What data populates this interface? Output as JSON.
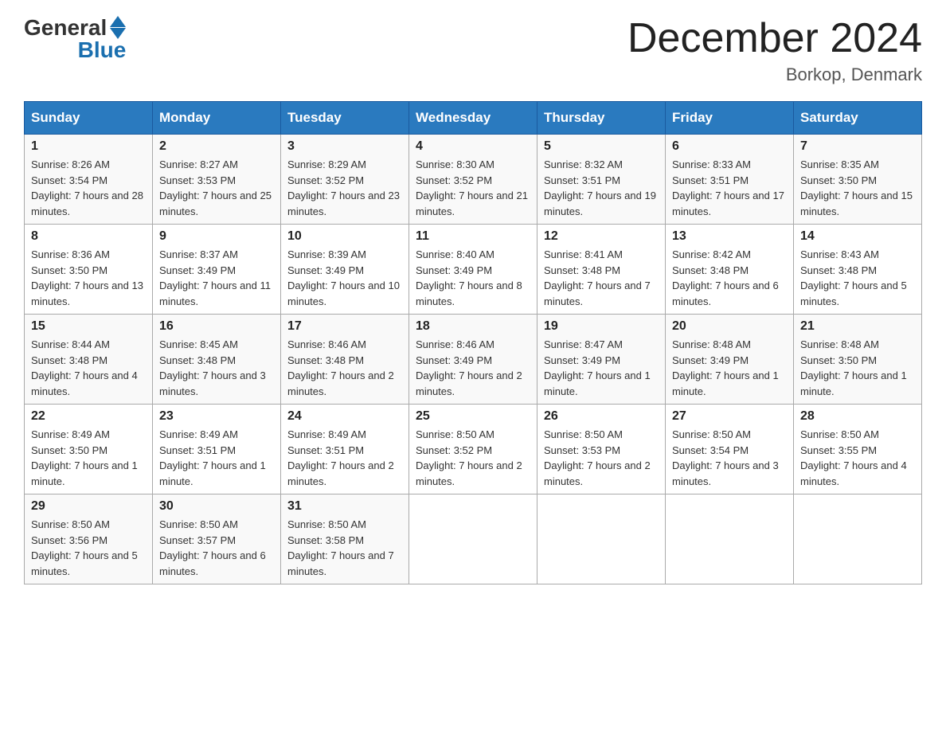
{
  "header": {
    "logo_general": "General",
    "logo_blue": "Blue",
    "title": "December 2024",
    "subtitle": "Borkop, Denmark"
  },
  "weekdays": [
    "Sunday",
    "Monday",
    "Tuesday",
    "Wednesday",
    "Thursday",
    "Friday",
    "Saturday"
  ],
  "weeks": [
    [
      {
        "day": "1",
        "sunrise": "8:26 AM",
        "sunset": "3:54 PM",
        "daylight": "7 hours and 28 minutes."
      },
      {
        "day": "2",
        "sunrise": "8:27 AM",
        "sunset": "3:53 PM",
        "daylight": "7 hours and 25 minutes."
      },
      {
        "day": "3",
        "sunrise": "8:29 AM",
        "sunset": "3:52 PM",
        "daylight": "7 hours and 23 minutes."
      },
      {
        "day": "4",
        "sunrise": "8:30 AM",
        "sunset": "3:52 PM",
        "daylight": "7 hours and 21 minutes."
      },
      {
        "day": "5",
        "sunrise": "8:32 AM",
        "sunset": "3:51 PM",
        "daylight": "7 hours and 19 minutes."
      },
      {
        "day": "6",
        "sunrise": "8:33 AM",
        "sunset": "3:51 PM",
        "daylight": "7 hours and 17 minutes."
      },
      {
        "day": "7",
        "sunrise": "8:35 AM",
        "sunset": "3:50 PM",
        "daylight": "7 hours and 15 minutes."
      }
    ],
    [
      {
        "day": "8",
        "sunrise": "8:36 AM",
        "sunset": "3:50 PM",
        "daylight": "7 hours and 13 minutes."
      },
      {
        "day": "9",
        "sunrise": "8:37 AM",
        "sunset": "3:49 PM",
        "daylight": "7 hours and 11 minutes."
      },
      {
        "day": "10",
        "sunrise": "8:39 AM",
        "sunset": "3:49 PM",
        "daylight": "7 hours and 10 minutes."
      },
      {
        "day": "11",
        "sunrise": "8:40 AM",
        "sunset": "3:49 PM",
        "daylight": "7 hours and 8 minutes."
      },
      {
        "day": "12",
        "sunrise": "8:41 AM",
        "sunset": "3:48 PM",
        "daylight": "7 hours and 7 minutes."
      },
      {
        "day": "13",
        "sunrise": "8:42 AM",
        "sunset": "3:48 PM",
        "daylight": "7 hours and 6 minutes."
      },
      {
        "day": "14",
        "sunrise": "8:43 AM",
        "sunset": "3:48 PM",
        "daylight": "7 hours and 5 minutes."
      }
    ],
    [
      {
        "day": "15",
        "sunrise": "8:44 AM",
        "sunset": "3:48 PM",
        "daylight": "7 hours and 4 minutes."
      },
      {
        "day": "16",
        "sunrise": "8:45 AM",
        "sunset": "3:48 PM",
        "daylight": "7 hours and 3 minutes."
      },
      {
        "day": "17",
        "sunrise": "8:46 AM",
        "sunset": "3:48 PM",
        "daylight": "7 hours and 2 minutes."
      },
      {
        "day": "18",
        "sunrise": "8:46 AM",
        "sunset": "3:49 PM",
        "daylight": "7 hours and 2 minutes."
      },
      {
        "day": "19",
        "sunrise": "8:47 AM",
        "sunset": "3:49 PM",
        "daylight": "7 hours and 1 minute."
      },
      {
        "day": "20",
        "sunrise": "8:48 AM",
        "sunset": "3:49 PM",
        "daylight": "7 hours and 1 minute."
      },
      {
        "day": "21",
        "sunrise": "8:48 AM",
        "sunset": "3:50 PM",
        "daylight": "7 hours and 1 minute."
      }
    ],
    [
      {
        "day": "22",
        "sunrise": "8:49 AM",
        "sunset": "3:50 PM",
        "daylight": "7 hours and 1 minute."
      },
      {
        "day": "23",
        "sunrise": "8:49 AM",
        "sunset": "3:51 PM",
        "daylight": "7 hours and 1 minute."
      },
      {
        "day": "24",
        "sunrise": "8:49 AM",
        "sunset": "3:51 PM",
        "daylight": "7 hours and 2 minutes."
      },
      {
        "day": "25",
        "sunrise": "8:50 AM",
        "sunset": "3:52 PM",
        "daylight": "7 hours and 2 minutes."
      },
      {
        "day": "26",
        "sunrise": "8:50 AM",
        "sunset": "3:53 PM",
        "daylight": "7 hours and 2 minutes."
      },
      {
        "day": "27",
        "sunrise": "8:50 AM",
        "sunset": "3:54 PM",
        "daylight": "7 hours and 3 minutes."
      },
      {
        "day": "28",
        "sunrise": "8:50 AM",
        "sunset": "3:55 PM",
        "daylight": "7 hours and 4 minutes."
      }
    ],
    [
      {
        "day": "29",
        "sunrise": "8:50 AM",
        "sunset": "3:56 PM",
        "daylight": "7 hours and 5 minutes."
      },
      {
        "day": "30",
        "sunrise": "8:50 AM",
        "sunset": "3:57 PM",
        "daylight": "7 hours and 6 minutes."
      },
      {
        "day": "31",
        "sunrise": "8:50 AM",
        "sunset": "3:58 PM",
        "daylight": "7 hours and 7 minutes."
      },
      null,
      null,
      null,
      null
    ]
  ]
}
